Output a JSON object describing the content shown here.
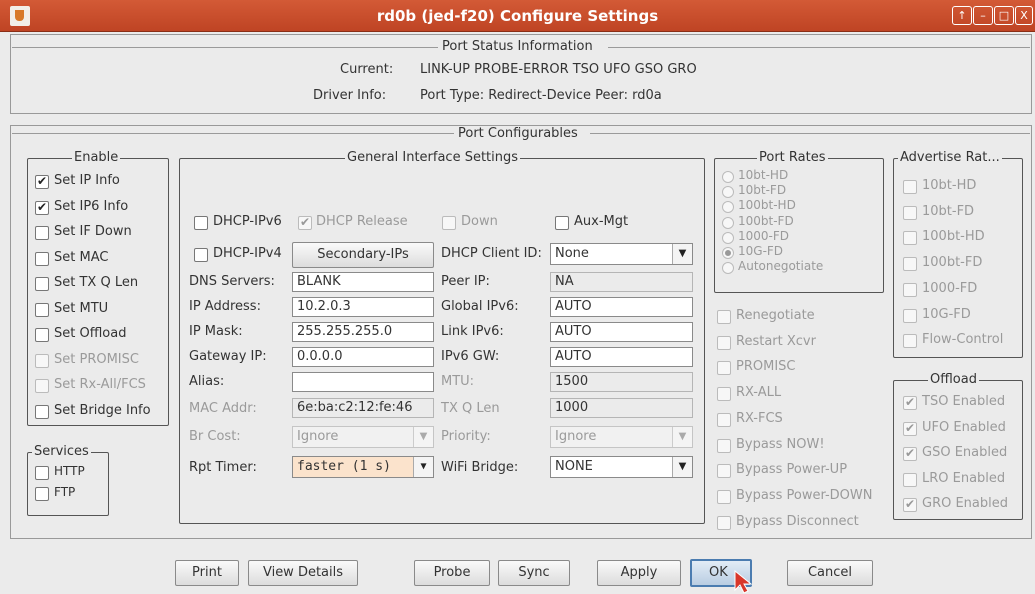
{
  "window": {
    "title": "rd0b  (jed-f20) Configure Settings",
    "buttons": [
      "↑",
      "–",
      "□",
      "X"
    ]
  },
  "status": {
    "title": "Port Status Information",
    "current_label": "Current:",
    "current_value": "LINK-UP PROBE-ERROR TSO UFO GSO GRO",
    "driver_label": "Driver Info:",
    "driver_value": "Port Type: Redirect-Device   Peer: rd0a"
  },
  "configurables_title": "Port Configurables",
  "enable": {
    "title": "Enable",
    "items": [
      {
        "label": "Set IP Info",
        "checked": true,
        "enabled": true
      },
      {
        "label": "Set IP6 Info",
        "checked": true,
        "enabled": true
      },
      {
        "label": "Set IF Down",
        "checked": false,
        "enabled": true
      },
      {
        "label": "Set MAC",
        "checked": false,
        "enabled": true
      },
      {
        "label": "Set TX Q Len",
        "checked": false,
        "enabled": true
      },
      {
        "label": "Set MTU",
        "checked": false,
        "enabled": true
      },
      {
        "label": "Set Offload",
        "checked": false,
        "enabled": true
      },
      {
        "label": "Set PROMISC",
        "checked": false,
        "enabled": false
      },
      {
        "label": "Set Rx-All/FCS",
        "checked": false,
        "enabled": false
      },
      {
        "label": "Set Bridge Info",
        "checked": false,
        "enabled": true
      }
    ]
  },
  "services": {
    "title": "Services",
    "items": [
      {
        "label": "HTTP",
        "checked": false
      },
      {
        "label": "FTP",
        "checked": false
      }
    ]
  },
  "general": {
    "title": "General Interface Settings",
    "dhcp_ipv6": "DHCP-IPv6",
    "dhcp_release": "DHCP Release",
    "down": "Down",
    "aux_mgt": "Aux-Mgt",
    "dhcp_ipv4": "DHCP-IPv4",
    "secondary_ips": "Secondary-IPs",
    "dhcp_client_id_label": "DHCP Client ID:",
    "dhcp_client_id_value": "None",
    "dns_label": "DNS Servers:",
    "dns_value": "BLANK",
    "peer_ip_label": "Peer IP:",
    "peer_ip_value": "NA",
    "ip_label": "IP Address:",
    "ip_value": "10.2.0.3",
    "global_ipv6_label": "Global IPv6:",
    "global_ipv6_value": "AUTO",
    "mask_label": "IP Mask:",
    "mask_value": "255.255.255.0",
    "link_ipv6_label": "Link IPv6:",
    "link_ipv6_value": "AUTO",
    "gw_label": "Gateway IP:",
    "gw_value": "0.0.0.0",
    "ipv6_gw_label": "IPv6 GW:",
    "ipv6_gw_value": "AUTO",
    "alias_label": "Alias:",
    "alias_value": "",
    "mtu_label": "MTU:",
    "mtu_value": "1500",
    "mac_label": "MAC Addr:",
    "mac_value": "6e:ba:c2:12:fe:46",
    "txq_label": "TX Q Len",
    "txq_value": "1000",
    "brcost_label": "Br Cost:",
    "brcost_value": "Ignore",
    "priority_label": "Priority:",
    "priority_value": "Ignore",
    "rpt_label": "Rpt Timer:",
    "rpt_value": "faster  (1 s)",
    "wifi_label": "WiFi Bridge:",
    "wifi_value": "NONE"
  },
  "rates": {
    "title": "Port Rates",
    "items": [
      {
        "label": "10bt-HD",
        "selected": false
      },
      {
        "label": "10bt-FD",
        "selected": false
      },
      {
        "label": "100bt-HD",
        "selected": false
      },
      {
        "label": "100bt-FD",
        "selected": false
      },
      {
        "label": "1000-FD",
        "selected": false
      },
      {
        "label": "10G-FD",
        "selected": true
      },
      {
        "label": "Autonegotiate",
        "selected": false
      }
    ]
  },
  "port_options": [
    "Renegotiate",
    "Restart Xcvr",
    "PROMISC",
    "RX-ALL",
    "RX-FCS",
    "Bypass NOW!",
    "Bypass Power-UP",
    "Bypass Power-DOWN",
    "Bypass Disconnect"
  ],
  "advertise": {
    "title": "Advertise Rat...",
    "items": [
      "10bt-HD",
      "10bt-FD",
      "100bt-HD",
      "100bt-FD",
      "1000-FD",
      "10G-FD",
      "Flow-Control"
    ]
  },
  "offload": {
    "title": "Offload",
    "items": [
      {
        "label": "TSO Enabled",
        "checked": true
      },
      {
        "label": "UFO Enabled",
        "checked": true
      },
      {
        "label": "GSO Enabled",
        "checked": true
      },
      {
        "label": "LRO Enabled",
        "checked": false
      },
      {
        "label": "GRO Enabled",
        "checked": true
      }
    ]
  },
  "buttons": {
    "print": "Print",
    "view_details": "View Details",
    "probe": "Probe",
    "sync": "Sync",
    "apply": "Apply",
    "ok": "OK",
    "cancel": "Cancel"
  }
}
